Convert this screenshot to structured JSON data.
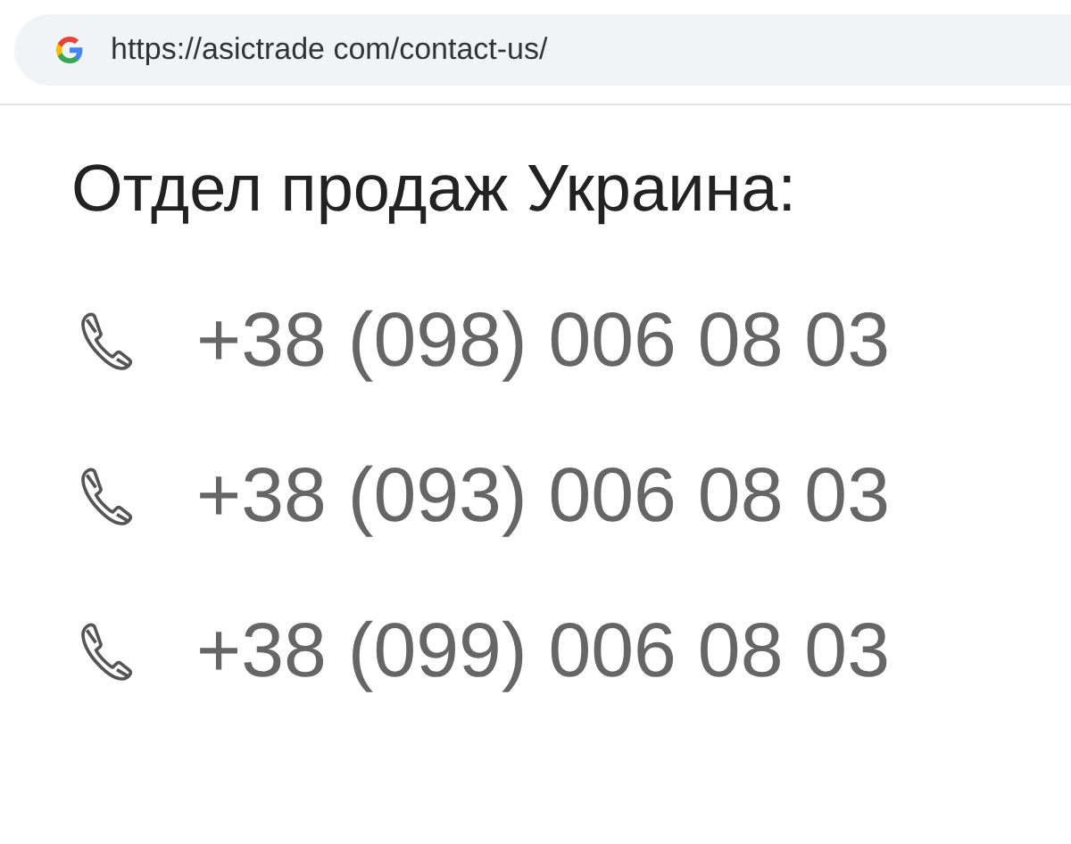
{
  "address_bar": {
    "url": "https://asictrade com/contact-us/"
  },
  "heading": "Отдел продаж Украина:",
  "phones": [
    "+38 (098) 006 08 03",
    "+38 (093) 006 08 03",
    "+38 (099) 006 08 03"
  ]
}
